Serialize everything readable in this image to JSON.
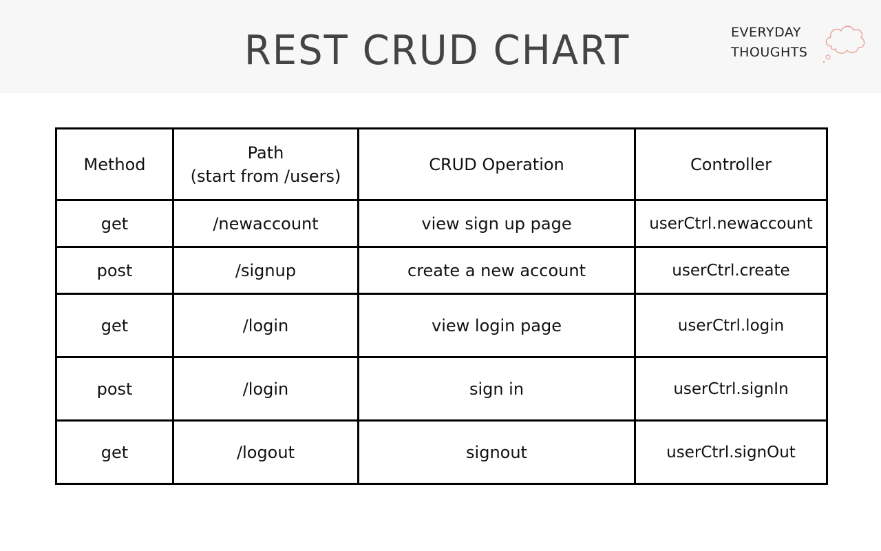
{
  "header": {
    "title": "REST CRUD CHART",
    "brand_line1": "EVERYDAY",
    "brand_line2": "THOUGHTS",
    "brand_icon": "thought-cloud-icon",
    "background": "#f7f7f7",
    "accent": "#e8a29a"
  },
  "table": {
    "headers": {
      "method": "Method",
      "path_line1": "Path",
      "path_line2": "(start from /users)",
      "operation": "CRUD Operation",
      "controller": "Controller"
    },
    "rows": [
      {
        "method": "get",
        "path": "/newaccount",
        "operation": "view sign up page",
        "controller": "userCtrl.newaccount"
      },
      {
        "method": "post",
        "path": "/signup",
        "operation": "create a new account",
        "controller": "userCtrl.create"
      },
      {
        "method": "get",
        "path": "/login",
        "operation": "view login page",
        "controller": "userCtrl.login"
      },
      {
        "method": "post",
        "path": "/login",
        "operation": "sign in",
        "controller": "userCtrl.signIn"
      },
      {
        "method": "get",
        "path": "/logout",
        "operation": "signout",
        "controller": "userCtrl.signOut"
      }
    ]
  }
}
